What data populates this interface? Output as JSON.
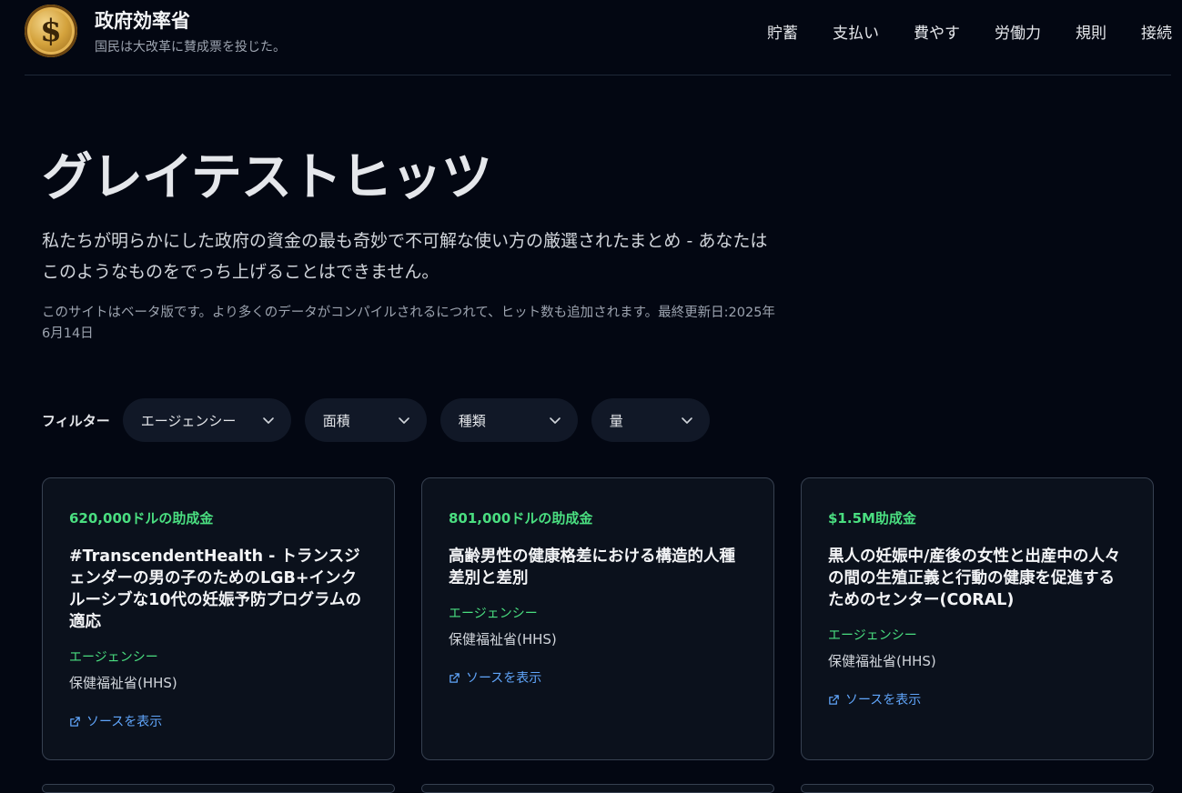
{
  "header": {
    "logo_icon": "dollar-coin-icon",
    "logo_symbol": "$",
    "title": "政府効率省",
    "tagline": "国民は大改革に賛成票を投じた。",
    "nav": [
      "貯蓄",
      "支払い",
      "費やす",
      "労働力",
      "規則",
      "接続"
    ]
  },
  "hero": {
    "title": "グレイテストヒッツ",
    "subtitle": "私たちが明らかにした政府の資金の最も奇妙で不可解な使い方の厳選されたまとめ - あなたはこのようなものをでっち上げることはできません。",
    "note": "このサイトはベータ版です。より多くのデータがコンパイルされるにつれて、ヒット数も追加されます。最終更新日:2025年6月14日"
  },
  "filters": {
    "label": "フィルター",
    "selects": [
      {
        "label": "エージェンシー",
        "icon": "chevron-down-icon"
      },
      {
        "label": "面積",
        "icon": "chevron-down-icon"
      },
      {
        "label": "種類",
        "icon": "chevron-down-icon"
      },
      {
        "label": "量",
        "icon": "chevron-down-icon"
      }
    ]
  },
  "cards": [
    {
      "amount": "620,000ドルの助成金",
      "title": "#TranscendentHealth - トランスジェンダーの男の子のためのLGB+インクルーシブな10代の妊娠予防プログラムの適応",
      "agency_label": "エージェンシー",
      "agency": "保健福祉省(HHS)",
      "source_label": "ソースを表示",
      "source_icon": "external-link-icon"
    },
    {
      "amount": "801,000ドルの助成金",
      "title": "高齢男性の健康格差における構造的人種差別と差別",
      "agency_label": "エージェンシー",
      "agency": "保健福祉省(HHS)",
      "source_label": "ソースを表示",
      "source_icon": "external-link-icon"
    },
    {
      "amount": "$1.5M助成金",
      "title": "黒人の妊娠中/産後の女性と出産中の人々の間の生殖正義と行動の健康を促進するためのセンター(CORAL)",
      "agency_label": "エージェンシー",
      "agency": "保健福祉省(HHS)",
      "source_label": "ソースを表示",
      "source_icon": "external-link-icon"
    }
  ],
  "colors": {
    "background": "#030712",
    "accent_green": "#4ade80",
    "link_blue": "#60a5fa",
    "card_border": "#374151"
  }
}
